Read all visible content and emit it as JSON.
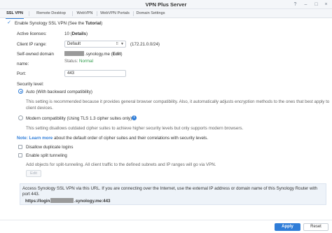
{
  "window": {
    "title": "VPN Plus Server"
  },
  "tabs": [
    {
      "label": "SSL VPN",
      "active": true
    },
    {
      "label": "Remote Desktop"
    },
    {
      "label": "WebVPN"
    },
    {
      "label": "WebVPN Portals"
    },
    {
      "label": "Domain Settings"
    }
  ],
  "enable": {
    "label": "Enable Synology SSL VPN (See the",
    "link": "Tutorial",
    "suffix": ")",
    "checked": true
  },
  "active_licenses": {
    "label": "Active licenses:",
    "value": "10 (",
    "link": "Details",
    "suffix": ")"
  },
  "client_ip_range": {
    "label": "Client IP range:",
    "value": "Default",
    "range": "(172.21.0.0/24)"
  },
  "domain": {
    "label": "Self-owned domain",
    "label2": "name:",
    "suffix": ".synology.me (",
    "edit": "Edit",
    "edit_close": ")",
    "status_label": "Status:",
    "status_value": "Normal"
  },
  "port": {
    "label": "Port:",
    "value": "443"
  },
  "security_level": {
    "label": "Security level:",
    "auto_label": "Auto (With backward compatibility)",
    "auto_desc_1": "This setting is recommended because it provides general browser compatibility. Also, it automatically adjusts encryption methods to the ones that best apply to",
    "auto_desc_2": "client devices.",
    "modern_label": "Modern compatibility (Using TLS 1.3 cipher suites only)",
    "modern_desc": "This setting disallows outdated cipher suites to achieve higher security levels but only supports modern browsers."
  },
  "note": {
    "prefix": "Note:",
    "link": "Learn more",
    "text": "about the default order of cipher suites and their correlations with security levels."
  },
  "disallow_duplicate": {
    "label": "Disallow duplicate logins",
    "checked": false
  },
  "split_tunneling": {
    "label": "Enable split tunneling",
    "checked": false,
    "desc": "Add objects for split-tunneling. All client traffic to the defined subnets and IP ranges will go via VPN.",
    "edit_button": "Edit"
  },
  "access_notice": {
    "line1": "Access Synology SSL VPN via this URL. If you are connecting over the Internet, use the external IP address or domain name of this Synology Router with",
    "line2": "port 443.",
    "url_prefix": "https://login.",
    "url_suffix": ".synology.me:443"
  },
  "footer": {
    "apply": "Apply",
    "reset": "Reset"
  },
  "colors": {
    "accent": "#2f7dd8",
    "status_ok": "#2c9a48"
  }
}
